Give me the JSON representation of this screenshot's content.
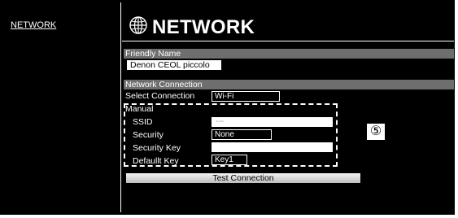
{
  "sidebar": {
    "items": [
      {
        "label": "NETWORK"
      }
    ]
  },
  "header": {
    "title": "NETWORK",
    "icon": "globe-icon"
  },
  "friendly_name": {
    "section_label": "Friendly Name",
    "value": "Denon CEOL piccolo"
  },
  "network_connection": {
    "section_label": "Network Connection",
    "select_connection_label": "Select Connection",
    "select_connection_value": "Wi-Fi",
    "manual_label": "Manual",
    "ssid_label": "SSID",
    "ssid_value": "---",
    "security_label": "Security",
    "security_value": "None",
    "security_key_label": "Security Key",
    "security_key_value": "",
    "default_key_label": "Defaullt Key",
    "default_key_value": "Key1"
  },
  "test_button_label": "Test Connection",
  "callout": {
    "label": "⑤"
  },
  "colors": {
    "background": "#000000",
    "section_bar": "#6e6e6e",
    "text": "#ffffff"
  }
}
